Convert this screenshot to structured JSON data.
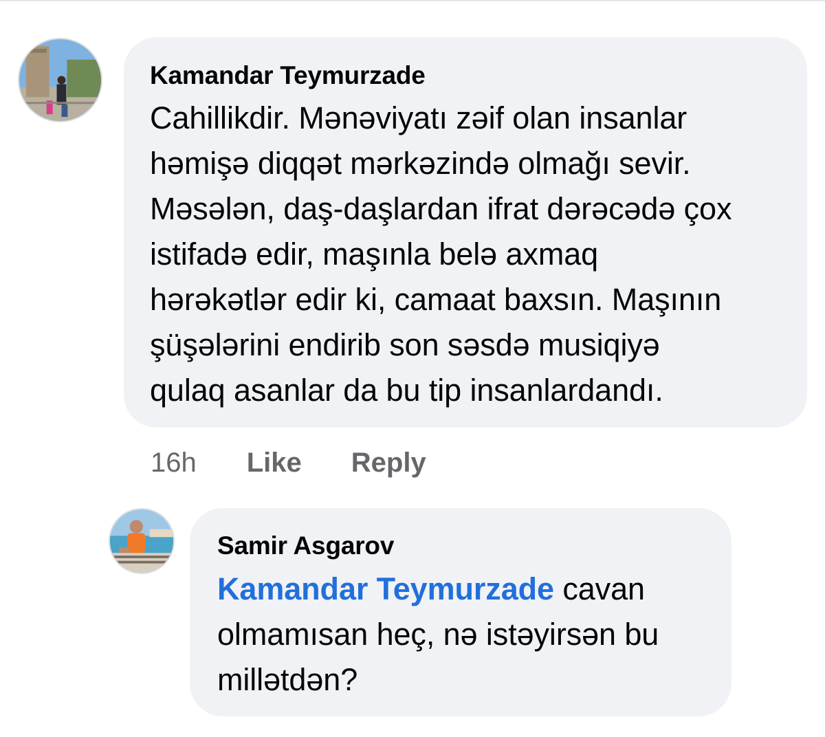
{
  "comment": {
    "author": "Kamandar Teymurzade",
    "lines": [
      "Cahillikdir. Mənəviyatı zəif olan insanlar",
      "həmişə diqqət mərkəzində olmağı sevir.",
      "Məsələn, daş-daşlardan ifrat dərəcədə çox",
      "istifadə edir, maşınla belə axmaq",
      "hərəkətlər edir ki, camaat baxsın. Maşının",
      "şüşələrini endirib son səsdə musiqiyə",
      "qulaq asanlar da bu tip insanlardandı."
    ],
    "time": "16h",
    "like_label": "Like",
    "reply_label": "Reply"
  },
  "reply": {
    "author": "Samir Asgarov",
    "mention": "Kamandar Teymurzade",
    "first_line_rest": " cavan",
    "lines": [
      "olmamısan heç, nə istəyirsən bu",
      "millətdən?"
    ]
  },
  "colors": {
    "bubble": "#f0f2f5",
    "mention": "#216fdb",
    "meta": "#65676b"
  }
}
